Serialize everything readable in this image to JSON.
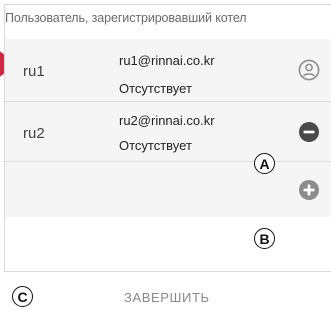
{
  "header": {
    "title": "Пользователь, зарегистрировавший котел"
  },
  "users": [
    {
      "name": "ru1",
      "email": "ru1@rinnai.co.kr",
      "status": "Отсутствует",
      "action_icon": "user-icon"
    },
    {
      "name": "ru2",
      "email": "ru2@rinnai.co.kr",
      "status": "Отсутствует",
      "action_icon": "remove-icon"
    }
  ],
  "add_row": {
    "icon": "add-icon"
  },
  "callouts": {
    "a": "A",
    "b": "B",
    "c": "C"
  },
  "footer": {
    "finish_label": "ЗАВЕРШИТЬ"
  },
  "colors": {
    "accent_red": "#c8102e",
    "icon_dark": "#4a4a4a",
    "icon_gray": "#8c8c8c",
    "list_background": "#f5f5f5"
  }
}
